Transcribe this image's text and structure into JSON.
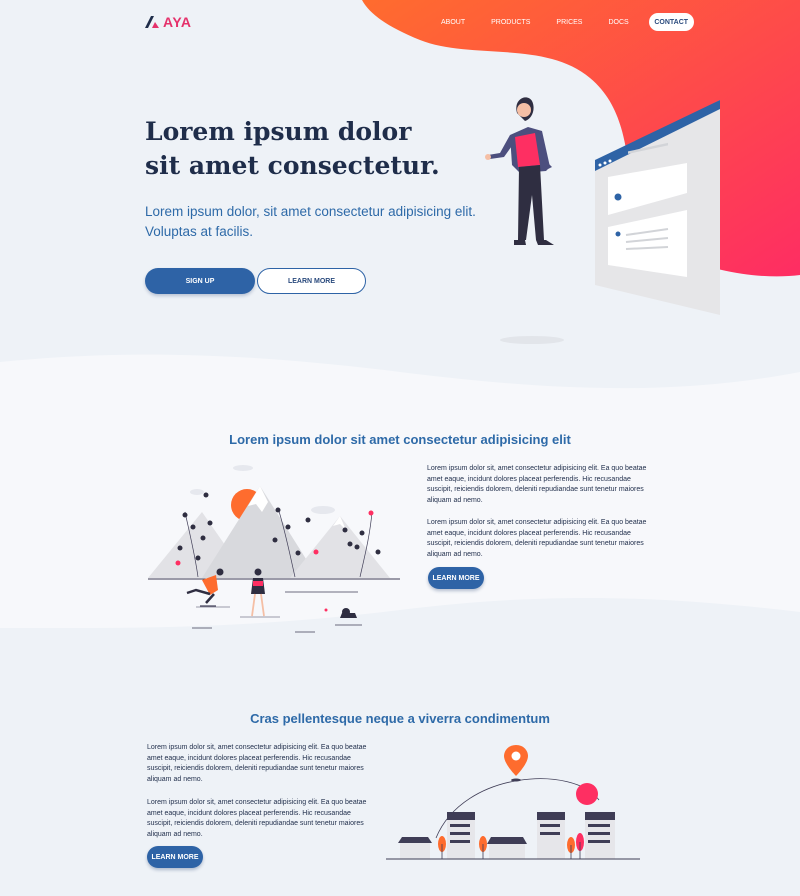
{
  "brand": {
    "name": "AYA"
  },
  "nav": {
    "links": [
      "ABOUT",
      "PRODUCTS",
      "PRICES",
      "DOCS"
    ],
    "cta": "CONTACT"
  },
  "hero": {
    "title_line1": "Lorem ipsum dolor",
    "title_line2": "sit amet consectetur.",
    "subtitle_line1": "Lorem ipsum dolor, sit amet consectetur adipisicing elit.",
    "subtitle_line2": "Voluptas at facilis.",
    "primary_button": "SIGN UP",
    "secondary_button": "LEARN MORE"
  },
  "section_features": {
    "title": "Lorem ipsum dolor sit amet consectetur adipisicing elit",
    "paragraph1": "Lorem ipsum dolor sit, amet consectetur adipisicing elit. Ea quo beatae amet eaque, incidunt dolores placeat perferendis. Hic recusandae suscipit, reiciendis dolorem, deleniti repudiandae sunt tenetur maiores aliquam ad nemo.",
    "paragraph2": "Lorem ipsum dolor sit, amet consectetur adipisicing elit. Ea quo beatae amet eaque, incidunt dolores placeat perferendis. Hic recusandae suscipit, reiciendis dolorem, deleniti repudiandae sunt tenetur maiores aliquam ad nemo.",
    "button": "LEARN MORE"
  },
  "section_city": {
    "title": "Cras pellentesque neque a viverra condimentum",
    "paragraph1": "Lorem ipsum dolor sit, amet consectetur adipisicing elit. Ea quo beatae amet eaque, incidunt dolores placeat perferendis. Hic recusandae suscipit, reiciendis dolorem, deleniti repudiandae sunt tenetur maiores aliquam ad nemo.",
    "paragraph2": "Lorem ipsum dolor sit, amet consectetur adipisicing elit. Ea quo beatae amet eaque, incidunt dolores placeat perferendis. Hic recusandae suscipit, reiciendis dolorem, deleniti repudiandae sunt tenetur maiores aliquam ad nemo.",
    "button": "LEARN MORE"
  },
  "colors": {
    "accent_gradient_start": "#ff6433",
    "accent_gradient_end": "#fe2f62",
    "primary_blue": "#2e63a6",
    "heading_navy": "#1f2d4a",
    "brand_pink": "#e5316b"
  },
  "icons": {
    "logo": "aya-logo-mark",
    "map_pin": "location-pin-icon"
  }
}
